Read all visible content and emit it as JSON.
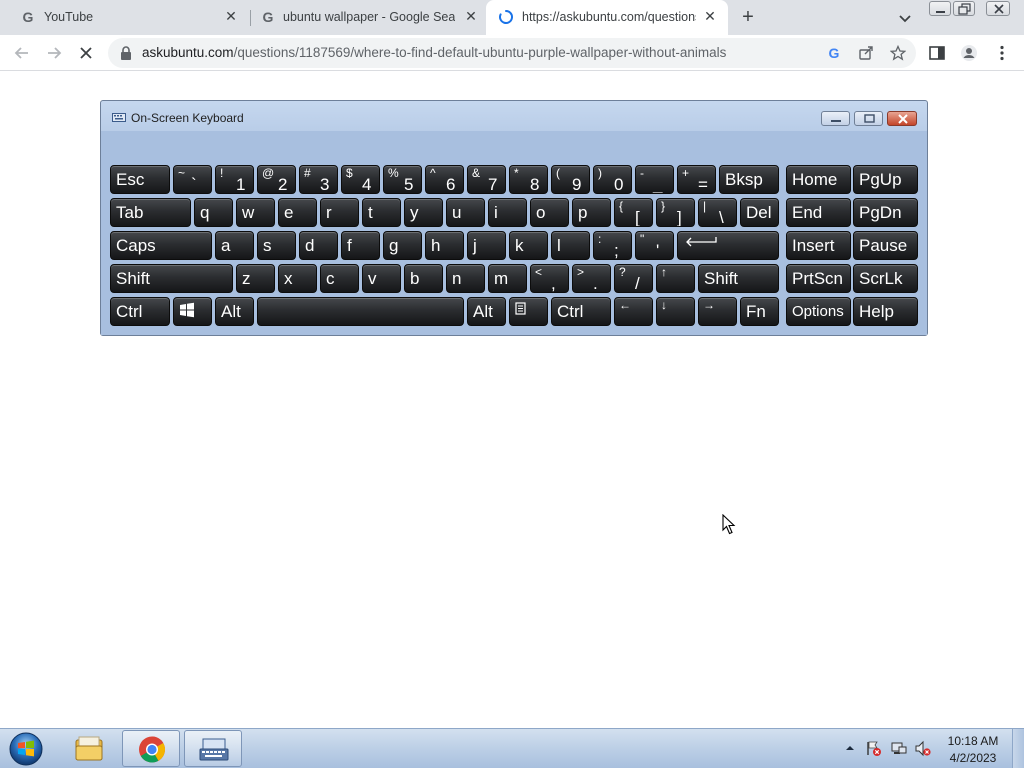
{
  "browser": {
    "tabs": [
      {
        "title": "YouTube",
        "favicon": "google-g-icon",
        "active": false
      },
      {
        "title": "ubuntu wallpaper - Google Searc",
        "favicon": "google-g-icon",
        "active": false
      },
      {
        "title": "https://askubuntu.com/questions",
        "favicon": "loading-spinner-icon",
        "active": true
      }
    ],
    "url_domain": "askubuntu.com",
    "url_path": "/questions/1187569/where-to-find-default-ubuntu-purple-wallpaper-without-animals",
    "loading": true
  },
  "osk": {
    "title": "On-Screen Keyboard",
    "rows": [
      [
        {
          "label": "Esc"
        },
        {
          "top": "~",
          "bottom": "`"
        },
        {
          "top": "!",
          "bottom": "1"
        },
        {
          "top": "@",
          "bottom": "2"
        },
        {
          "top": "#",
          "bottom": "3"
        },
        {
          "top": "$",
          "bottom": "4"
        },
        {
          "top": "%",
          "bottom": "5"
        },
        {
          "top": "^",
          "bottom": "6"
        },
        {
          "top": "&",
          "bottom": "7"
        },
        {
          "top": "*",
          "bottom": "8"
        },
        {
          "top": "(",
          "bottom": "9"
        },
        {
          "top": ")",
          "bottom": "0"
        },
        {
          "top": "-",
          "bottom": "_"
        },
        {
          "top": "+",
          "bottom": "="
        },
        {
          "label": "Bksp"
        },
        {
          "label": "Home"
        },
        {
          "label": "PgUp"
        }
      ],
      [
        {
          "label": "Tab"
        },
        {
          "label": "q"
        },
        {
          "label": "w"
        },
        {
          "label": "e"
        },
        {
          "label": "r"
        },
        {
          "label": "t"
        },
        {
          "label": "y"
        },
        {
          "label": "u"
        },
        {
          "label": "i"
        },
        {
          "label": "o"
        },
        {
          "label": "p"
        },
        {
          "top": "{",
          "bottom": "["
        },
        {
          "top": "}",
          "bottom": "]"
        },
        {
          "top": "|",
          "bottom": "\\"
        },
        {
          "label": "Del"
        },
        {
          "label": "End"
        },
        {
          "label": "PgDn"
        }
      ],
      [
        {
          "label": "Caps"
        },
        {
          "label": "a"
        },
        {
          "label": "s"
        },
        {
          "label": "d"
        },
        {
          "label": "f"
        },
        {
          "label": "g"
        },
        {
          "label": "h"
        },
        {
          "label": "j"
        },
        {
          "label": "k"
        },
        {
          "label": "l"
        },
        {
          "top": ":",
          "bottom": ";"
        },
        {
          "top": "\"",
          "bottom": "'"
        },
        {
          "icon": "enter-arrow-icon"
        },
        {
          "label": "Insert"
        },
        {
          "label": "Pause"
        }
      ],
      [
        {
          "label": "Shift"
        },
        {
          "label": "z"
        },
        {
          "label": "x"
        },
        {
          "label": "c"
        },
        {
          "label": "v"
        },
        {
          "label": "b"
        },
        {
          "label": "n"
        },
        {
          "label": "m"
        },
        {
          "top": "<",
          "bottom": ","
        },
        {
          "top": ">",
          "bottom": "."
        },
        {
          "top": "?",
          "bottom": "/"
        },
        {
          "top": "↑",
          "bottom": ""
        },
        {
          "label": "Shift"
        },
        {
          "label": "PrtScn"
        },
        {
          "label": "ScrLk"
        }
      ],
      [
        {
          "label": "Ctrl"
        },
        {
          "icon": "windows-logo-icon"
        },
        {
          "label": "Alt"
        },
        {
          "label": ""
        },
        {
          "label": "Alt"
        },
        {
          "icon": "context-menu-icon"
        },
        {
          "label": "Ctrl"
        },
        {
          "top": "←",
          "bottom": ""
        },
        {
          "top": "↓",
          "bottom": ""
        },
        {
          "top": "→",
          "bottom": ""
        },
        {
          "label": "Fn"
        },
        {
          "label": "Options"
        },
        {
          "label": "Help"
        }
      ]
    ]
  },
  "taskbar": {
    "apps": [
      {
        "name": "windows-explorer-icon",
        "open": false
      },
      {
        "name": "chrome-icon",
        "open": true
      },
      {
        "name": "on-screen-keyboard-icon",
        "open": true
      }
    ],
    "tray_icons": [
      "action-center-flag-icon",
      "network-icon",
      "volume-muted-icon"
    ],
    "time": "10:18 AM",
    "date": "4/2/2023"
  }
}
